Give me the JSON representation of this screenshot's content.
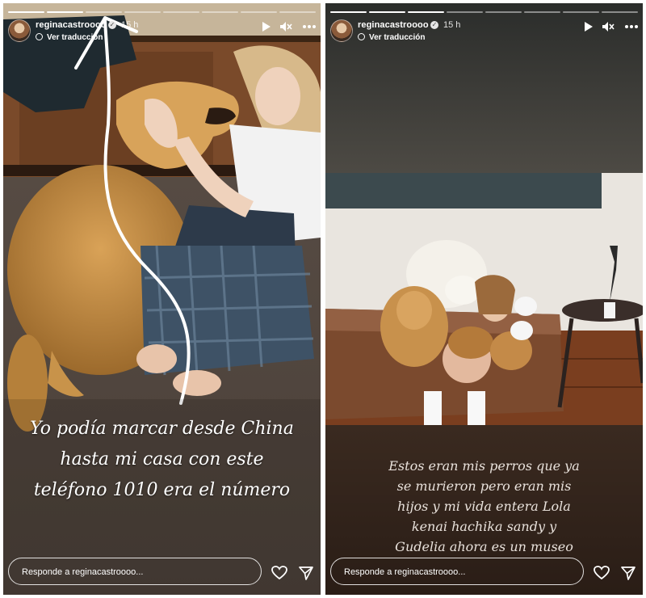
{
  "stories": [
    {
      "username": "reginacastroooo",
      "time": "15 h",
      "translate_label": "Ver traducción",
      "caption": [
        "Yo podía marcar desde China",
        "hasta mi casa con este",
        "teléfono 1010 era el número"
      ],
      "reply_placeholder": "Responde a reginacastroooo...",
      "progress": {
        "total": 8,
        "done": 2
      }
    },
    {
      "username": "reginacastroooo",
      "time": "15 h",
      "translate_label": "Ver traducción",
      "caption": [
        "Estos eran mis perros que ya",
        "se murieron pero eran mis",
        "hijos y mi vida entera Lola",
        "kenai hachika sandy y",
        "Gudelia ahora es un museo"
      ],
      "reply_placeholder": "Responde a reginacastroooo...",
      "progress": {
        "total": 8,
        "done": 3
      }
    }
  ],
  "icons": [
    "play-icon",
    "mute-icon",
    "more-icon",
    "heart-icon",
    "send-icon",
    "verified-icon",
    "globe-icon"
  ],
  "colors": {
    "verified_badge": "#e6e6e6",
    "text": "#ffffff"
  }
}
